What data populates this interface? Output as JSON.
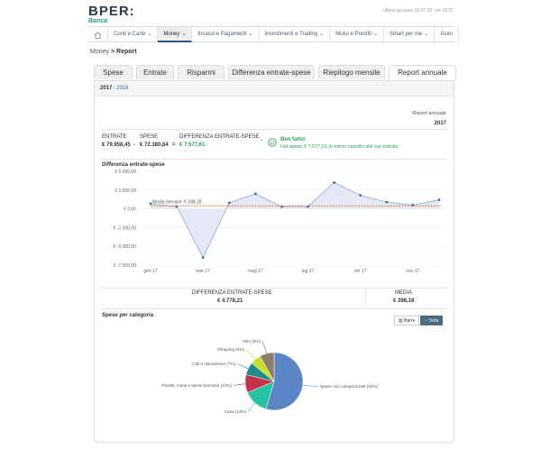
{
  "brand": {
    "name": "BPER:",
    "sub": "Banca"
  },
  "last_access": "Ultimo accesso 09.07.18. ore 10:21",
  "nav": {
    "items": [
      {
        "label": "Conti e Carte",
        "caret": "⌄",
        "active": false
      },
      {
        "label": "Money",
        "caret": "⌄",
        "active": true
      },
      {
        "label": "Incassi e Pagamenti",
        "caret": "⌄",
        "active": false
      },
      {
        "label": "Investimenti e Trading",
        "caret": "⌄",
        "active": false
      },
      {
        "label": "Mutui e Prestiti",
        "caret": "⌄",
        "active": false
      },
      {
        "label": "Smart per me",
        "caret": "⌄",
        "active": false
      },
      {
        "label": "Aiuto",
        "caret": "",
        "active": false
      }
    ]
  },
  "breadcrumb": {
    "parent": "Money",
    "sep": ">",
    "current": "Report"
  },
  "tabs": [
    "Spese",
    "Entrate",
    "Risparmi",
    "Differenza entrate-spese",
    "Riepilogo mensile",
    "Report annuale"
  ],
  "years": {
    "active": "2017",
    "sep": "|",
    "other": "2016"
  },
  "report": {
    "label": "Report annuale",
    "year": "2017",
    "entrate_label": "ENTRATE",
    "entrate_value": "€ 79.958,45",
    "minus": "-",
    "spese_label": "SPESE",
    "spese_value": "€ 72.380,84",
    "equals": "=",
    "diff_label": "DIFFERENZA ENTRATE-SPESE",
    "diff_value": "€ 7.577,61",
    "message_title": "Ben fatto!",
    "message_text": "Hai speso € 7.577,61 in meno rispetto alle tue entrate."
  },
  "diff_chart_title": "Differenza entrate-spese",
  "summary": {
    "diff_label": "DIFFERENZA ENTRATE-SPESE",
    "diff_value": "€ 4.778,21",
    "media_label": "MEDIA",
    "media_value": "€ 398,18"
  },
  "pie_title": "Spese per categoria",
  "buttons": {
    "bar": "Barre",
    "pie": "Torta"
  },
  "colors": {
    "accent": "#2a5a8a",
    "green": "#27a549",
    "mean_line": "#e07020"
  },
  "chart_data": [
    {
      "type": "area",
      "title": "Differenza entrate-spese",
      "categories": [
        "gen 17",
        "feb 17",
        "mar 17",
        "apr 17",
        "mag 17",
        "giu 17",
        "lug 17",
        "ago 17",
        "set 17",
        "ott 17",
        "nov 17",
        "dic 17"
      ],
      "tick_labels": [
        "gen 17",
        "mar 17",
        "mag 17",
        "lug 17",
        "set 17",
        "nov 17"
      ],
      "yticks": [
        "€ 5.000,00",
        "€ 2.500,00",
        "€ 0,00",
        "€ -2.500,00",
        "€ -5.000,00",
        "€ -7.500,00"
      ],
      "values": [
        700,
        300,
        -6500,
        800,
        2000,
        300,
        300,
        3500,
        1800,
        900,
        500,
        1200
      ],
      "mean": 398.18,
      "mean_label": "Media mensile: € 398,18",
      "ylim": [
        -7500,
        5000
      ],
      "grid": true
    },
    {
      "type": "pie",
      "title": "Spese per categoria",
      "slices": [
        {
          "label": "Spese non categorizzate (54%)",
          "value": 54,
          "color": "#5a86c5"
        },
        {
          "label": "Casa (14%)",
          "value": 14,
          "color": "#26c2a2"
        },
        {
          "label": "Prestiti, mutui e spese bancarie (10%)",
          "value": 10,
          "color": "#c5304a"
        },
        {
          "label": "Cibi e ristorazione (7%)",
          "value": 7,
          "color": "#1e8c8c"
        },
        {
          "label": "Shopping (6%)",
          "value": 6,
          "color": "#c8e028"
        },
        {
          "label": "Altro (8%)",
          "value": 8,
          "color": "#8f7d6b"
        }
      ]
    }
  ]
}
